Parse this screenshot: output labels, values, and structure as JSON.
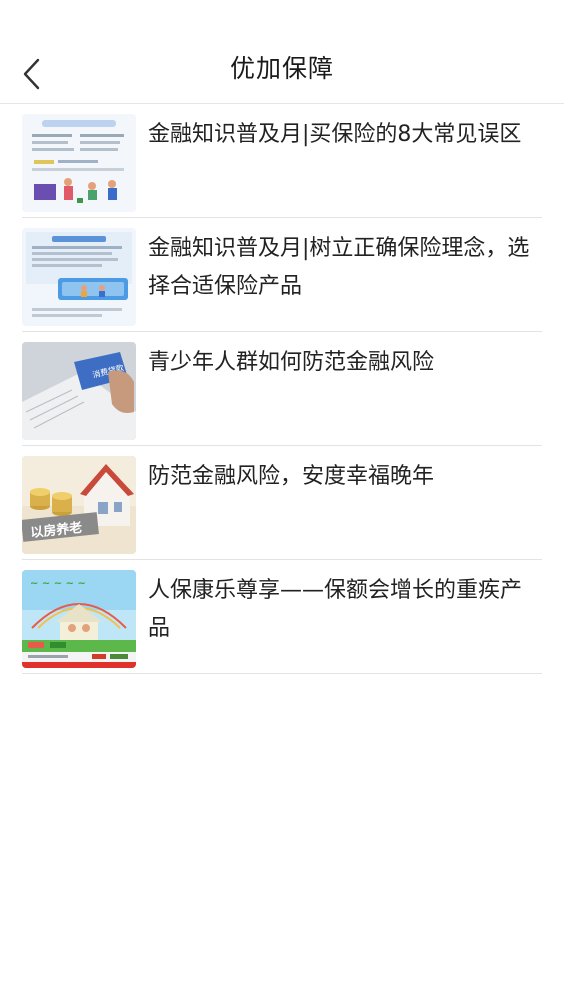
{
  "header": {
    "title": "优加保障",
    "back_icon": "chevron-left-icon"
  },
  "articles": [
    {
      "title": "金融知识普及月|买保险的8大常见误区"
    },
    {
      "title": "金融知识普及月|树立正确保险理念，选择合适保险产品"
    },
    {
      "title": "青少年人群如何防范金融风险"
    },
    {
      "title": "防范金融风险，安度幸福晚年"
    },
    {
      "title": "人保康乐尊享——保额会增长的重疾产品"
    }
  ],
  "colors": {
    "divider": "#e3e3e3",
    "text": "#222222"
  }
}
